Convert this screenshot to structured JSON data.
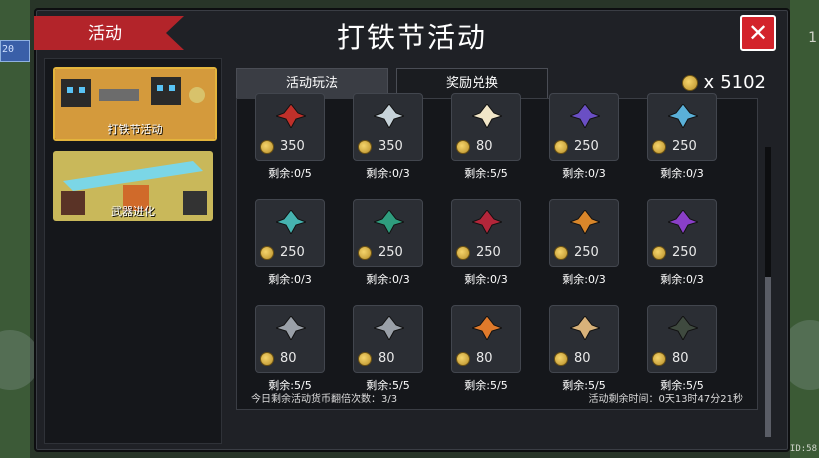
{
  "window": {
    "title": "打铁节活动",
    "ribbon_label": "活动",
    "close_glyph": "✕"
  },
  "background": {
    "left_value": "20",
    "right_value": "1",
    "uid": "UID:58"
  },
  "sidebar": {
    "cards": [
      {
        "label": "打铁节活动",
        "active": true
      },
      {
        "label": "武器进化",
        "active": false
      }
    ]
  },
  "tabs": [
    {
      "label": "活动玩法"
    },
    {
      "label": "奖励兑换"
    }
  ],
  "currency": {
    "prefix": "x",
    "amount": "5102"
  },
  "items": [
    {
      "icon": "red-flower-icon",
      "price": "350",
      "remain": "剩余:0/5",
      "color": "#c0302a"
    },
    {
      "icon": "white-flower-icon",
      "price": "350",
      "remain": "剩余:0/3",
      "color": "#c7d3da"
    },
    {
      "icon": "cream-bag-icon",
      "price": "80",
      "remain": "剩余:5/5",
      "color": "#f1e6c8"
    },
    {
      "icon": "purple-crystal-icon",
      "price": "250",
      "remain": "剩余:0/3",
      "color": "#6a4fc4"
    },
    {
      "icon": "blue-crystal-icon",
      "price": "250",
      "remain": "剩余:0/3",
      "color": "#5ab0d8"
    },
    {
      "icon": "teal-crystal-icon",
      "price": "250",
      "remain": "剩余:0/3",
      "color": "#46b3b0"
    },
    {
      "icon": "green-crystal-icon",
      "price": "250",
      "remain": "剩余:0/3",
      "color": "#2f9d7e"
    },
    {
      "icon": "red-crystal-icon",
      "price": "250",
      "remain": "剩余:0/3",
      "color": "#b3263a"
    },
    {
      "icon": "orange-crystal-icon",
      "price": "250",
      "remain": "剩余:0/3",
      "color": "#d9862a"
    },
    {
      "icon": "violet-crystal-icon",
      "price": "250",
      "remain": "剩余:0/3",
      "color": "#8a3fc8"
    },
    {
      "icon": "ore-lump-icon",
      "price": "80",
      "remain": "剩余:5/5",
      "color": "#9aa0a8"
    },
    {
      "icon": "gear-icon",
      "price": "80",
      "remain": "剩余:5/5",
      "color": "#9aa0a8"
    },
    {
      "icon": "copper-ore-icon",
      "price": "80",
      "remain": "剩余:5/5",
      "color": "#e07a2b"
    },
    {
      "icon": "wood-plank-icon",
      "price": "80",
      "remain": "剩余:5/5",
      "color": "#d8b27a"
    },
    {
      "icon": "battery-icon",
      "price": "80",
      "remain": "剩余:5/5",
      "color": "#3f4a3f"
    }
  ],
  "footer": {
    "left": "今日剩余活动货币翻倍次数：3/3",
    "right": "活动剩余时间：0天13时47分21秒"
  }
}
